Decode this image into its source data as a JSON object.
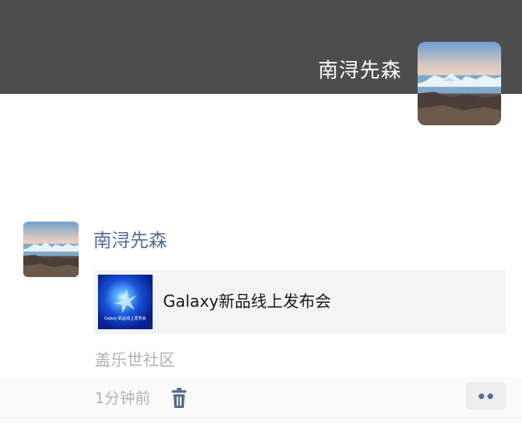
{
  "cover": {
    "username": "南浔先森"
  },
  "post": {
    "author": "南浔先森",
    "link_card": {
      "title": "Galaxy新品线上发布会",
      "thumbnail_text": "Galaxy 新品线上发布会"
    },
    "source": "盖乐世社区",
    "time": "1分钟前"
  },
  "icons": {
    "delete": "trash-icon",
    "more": "more-dots-icon"
  },
  "colors": {
    "cover_bg": "#4d4d4d",
    "author_name": "#576b95",
    "meta_text": "#b2b2b2",
    "card_bg": "#f4f4f4"
  }
}
